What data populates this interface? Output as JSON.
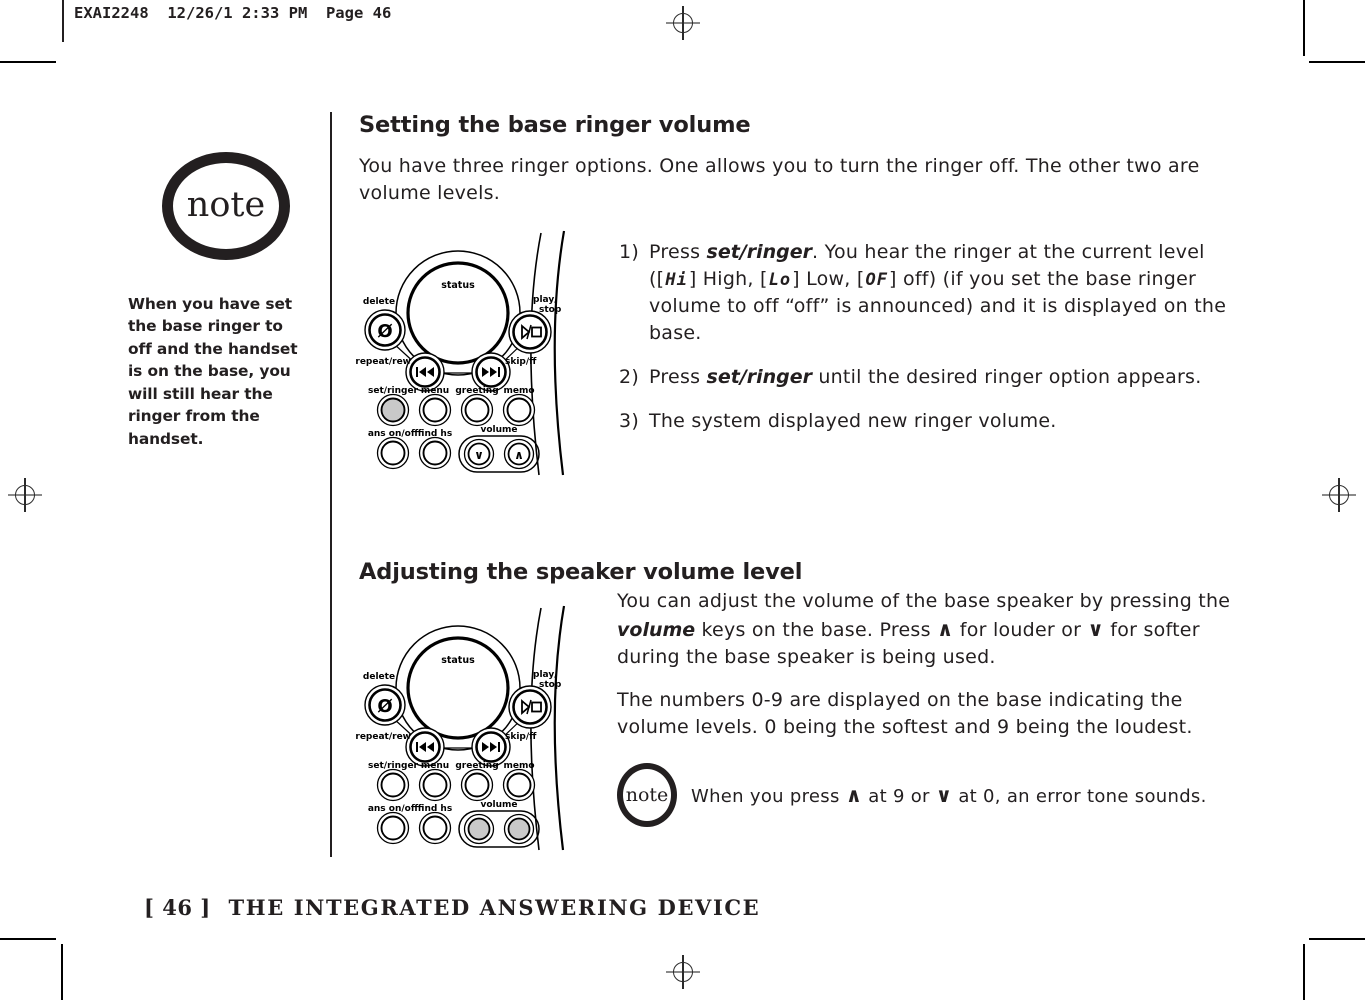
{
  "print_marks": {
    "header_text": "EXAI2248  12/26/1 2:33 PM  Page 46"
  },
  "side_note": {
    "badge_label": "note",
    "text": "When you have set the base ringer to off and the handset is on the base, you will still hear the ringer from the handset."
  },
  "sections": [
    {
      "heading": "Setting the base ringer volume",
      "intro": "You have three ringer options. One allows you to turn the ringer off. The other two are volume levels.",
      "steps": [
        {
          "number": "1)",
          "parts": [
            {
              "t": "text",
              "v": "Press "
            },
            {
              "t": "bolditalic",
              "v": "set/ringer"
            },
            {
              "t": "text",
              "v": ". You hear the ringer at the current level (["
            },
            {
              "t": "lcd",
              "v": "Hi"
            },
            {
              "t": "text",
              "v": "] High, ["
            },
            {
              "t": "lcd",
              "v": "Lo"
            },
            {
              "t": "text",
              "v": "] Low, ["
            },
            {
              "t": "lcd",
              "v": "OF"
            },
            {
              "t": "text",
              "v": "] off) (if you set the base ringer volume to off “off” is announced) and it is displayed on the base."
            }
          ]
        },
        {
          "number": "2)",
          "parts": [
            {
              "t": "text",
              "v": "Press "
            },
            {
              "t": "bolditalic",
              "v": "set/ringer"
            },
            {
              "t": "text",
              "v": " until the desired ringer option appears."
            }
          ]
        },
        {
          "number": "3)",
          "parts": [
            {
              "t": "text",
              "v": "The system displayed new ringer volume."
            }
          ]
        }
      ]
    },
    {
      "heading": "Adjusting the speaker volume level",
      "paragraphs": [
        [
          {
            "t": "text",
            "v": "You can adjust the volume of the base speaker by pressing the "
          },
          {
            "t": "bolditalic",
            "v": "volume"
          },
          {
            "t": "text",
            "v": " keys on the base. Press "
          },
          {
            "t": "arrow",
            "v": "∧"
          },
          {
            "t": "text",
            "v": " for louder or "
          },
          {
            "t": "arrow",
            "v": "∨"
          },
          {
            "t": "text",
            "v": " for softer during the base speaker is being used."
          }
        ],
        [
          {
            "t": "text",
            "v": "The numbers 0-9 are displayed on the base indicating the volume levels. 0 being the softest and 9 being the loudest."
          }
        ]
      ],
      "inline_note": {
        "badge_label": "note",
        "parts": [
          {
            "t": "text",
            "v": "When you press "
          },
          {
            "t": "arrow",
            "v": "∧"
          },
          {
            "t": "text",
            "v": " at 9 or "
          },
          {
            "t": "arrow",
            "v": "∨"
          },
          {
            "t": "text",
            "v": " at 0, an error tone sounds."
          }
        ]
      }
    }
  ],
  "diagram": {
    "status_label": "status",
    "labels": {
      "delete": "delete",
      "play_stop_line1": "play/",
      "play_stop_line2": "stop",
      "repeat_rew": "repeat/rew",
      "skip_ff": "skip/ff",
      "set_ringer": "set/ringer",
      "menu": "menu",
      "greeting": "greeting",
      "memo": "memo",
      "ans_on_off": "ans on/off",
      "find_hs": "find hs",
      "volume": "volume"
    },
    "glyphs": {
      "delete": "Ø",
      "play": "▷",
      "slash": "/",
      "stop": "□",
      "rew": "❘◀◀",
      "ff": "▶▶❘",
      "vol_down": "∨",
      "vol_up": "∧"
    },
    "highlight_color": "#c9c9c9",
    "instances": [
      {
        "highlight": "set_ringer",
        "show_volume_glyphs": true
      },
      {
        "highlight": "volume",
        "show_volume_glyphs": false
      }
    ]
  },
  "footer": {
    "page_bracket": "[ 46 ]",
    "title": "THE INTEGRATED ANSWERING DEVICE"
  }
}
